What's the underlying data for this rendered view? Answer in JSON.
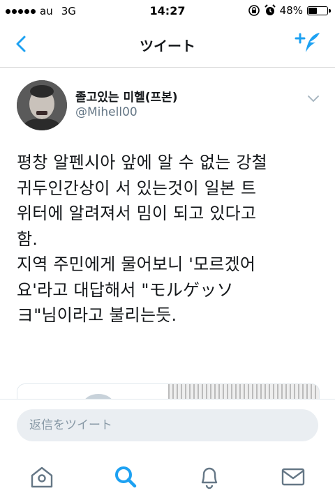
{
  "status": {
    "carrier": "au",
    "network": "3G",
    "time": "14:27",
    "battery": "48%",
    "battery_level": 0.48,
    "icons": [
      "orientation-lock-icon",
      "alarm-icon",
      "battery-icon"
    ]
  },
  "nav": {
    "title": "ツイート",
    "back_icon": "chevron-left-icon",
    "compose_icon": "compose-tweet-icon"
  },
  "tweet": {
    "name": "졸고있는 미헬(프본)",
    "handle": "@Mihell00",
    "text": "평창 알펜시아 앞에 알 수 없는 강철\n귀두인간상이 서 있는것이 일본 트\n위터에 알려져서 밈이 되고 있다고\n함.\n지역 주민에게 물어보니 '모르겠어\n요'라고 대답해서 \"モルゲッソ\nヨ\"님이라고 불리는듯."
  },
  "reply": {
    "placeholder": "返信をツイート"
  },
  "tabs": [
    "home-icon",
    "search-icon",
    "notifications-icon",
    "messages-icon"
  ],
  "colors": {
    "accent": "#1da1f2",
    "icon_gray": "#657786"
  }
}
